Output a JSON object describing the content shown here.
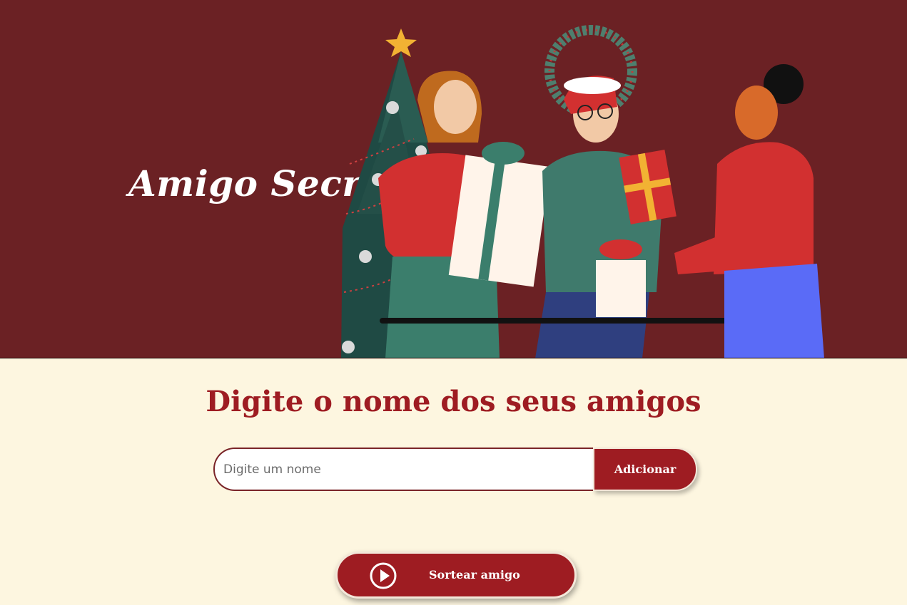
{
  "header": {
    "title": "Amigo Secreto",
    "illustration_icon": "christmas-gift-exchange-illustration"
  },
  "main": {
    "heading": "Digite o nome dos seus amigos",
    "input": {
      "placeholder": "Digite um nome",
      "value": ""
    },
    "add_button_label": "Adicionar",
    "draw_button_label": "Sortear amigo",
    "draw_button_icon": "play-circle-icon"
  },
  "colors": {
    "banner": "#6B2124",
    "background": "#FDF6E0",
    "accent": "#9E1C22",
    "heading": "#9E1C22"
  }
}
